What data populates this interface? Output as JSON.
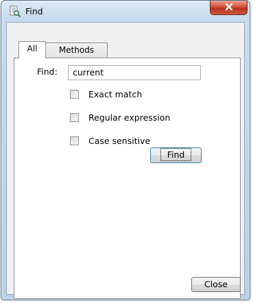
{
  "window": {
    "title": "Find",
    "icon": "find-document-icon",
    "close_icon": "x-close-icon"
  },
  "tabs": [
    {
      "label": "All",
      "active": true
    },
    {
      "label": "Methods",
      "active": false
    }
  ],
  "form": {
    "find_label": "Find:",
    "find_value": "current",
    "options": [
      {
        "label": "Exact match",
        "checked": false
      },
      {
        "label": "Regular expression",
        "checked": false
      },
      {
        "label": "Case sensitive",
        "checked": false
      }
    ],
    "find_button": "Find"
  },
  "footer": {
    "close_button": "Close"
  },
  "colors": {
    "title_gradient_top": "#dce9f6",
    "close_button_red": "#c8442b",
    "focus_border": "#3c7fb1"
  }
}
